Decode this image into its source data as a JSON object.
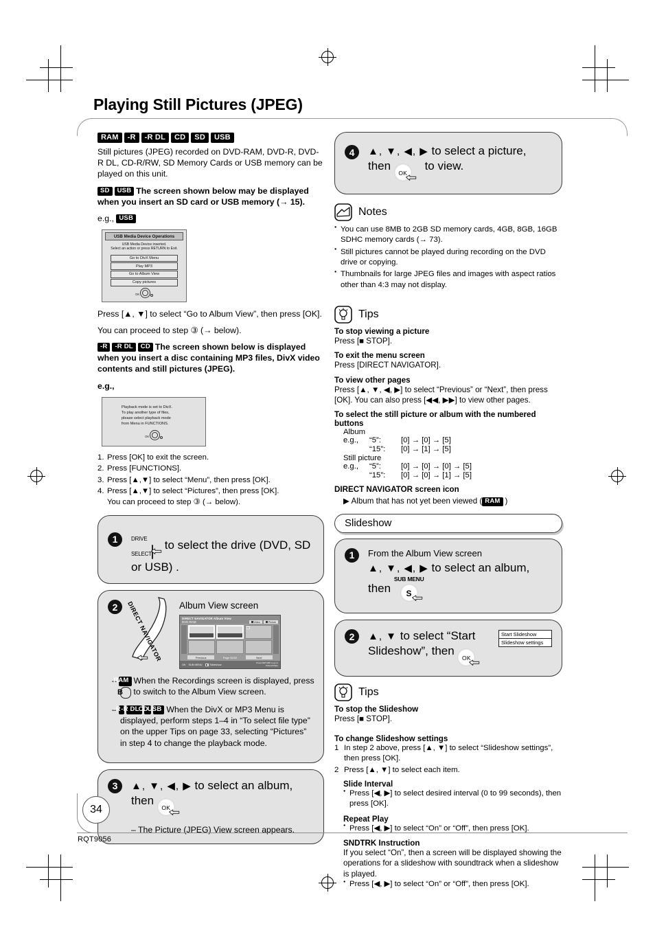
{
  "page": {
    "title": "Playing Still Pictures (JPEG)",
    "number": "34",
    "doc_code": "RQT9056"
  },
  "left": {
    "media_badges": [
      "RAM",
      "-R",
      "-R DL",
      "CD",
      "SD",
      "USB"
    ],
    "intro": "Still pictures (JPEG) recorded on DVD-RAM, DVD-R, DVD-R DL, CD-R/RW, SD Memory Cards or USB memory can be played on this unit.",
    "sd_usb_badges": [
      "SD",
      "USB"
    ],
    "sd_usb_text": "The screen shown below may be displayed when you insert an SD card or USB memory (→ 15).",
    "eg_label": "e.g.,",
    "eg_badge": "USB",
    "usb_screen": {
      "header": "USB Media Device Operations",
      "subtext_line1": "USB Media Device inserted.",
      "subtext_line2": "Select an action or press RETURN to Exit.",
      "options": [
        "Go to DivX Menu",
        "Play MP3",
        "Go to Album View",
        "Copy pictures"
      ],
      "ok_label": "OK"
    },
    "after_usb_line1": "Press [▲, ▼] to select “Go to Album View”, then press [OK].",
    "after_usb_line2": "You can proceed to step ③ (→ below).",
    "disc_badges": [
      "-R",
      "-R DL",
      "CD"
    ],
    "disc_text": "The screen shown below is displayed when you insert a disc containing MP3 files, DivX video contents and still pictures (JPEG).",
    "eg_label2": "e.g.,",
    "divx_screen": {
      "lines": [
        "Playback mode is set to DivX.",
        "To play another type of files,",
        "please select playback mode",
        "from Menu in FUNCTIONS."
      ],
      "ok_label": "OK"
    },
    "divx_steps": [
      "Press [OK] to exit the screen.",
      "Press [FUNCTIONS].",
      "Press [▲,▼] to select “Menu”, then press [OK].",
      "Press [▲,▼] to select “Pictures”, then press [OK]."
    ],
    "divx_steps_note": "You can proceed to step ③ (→ below).",
    "step1": {
      "num": "1",
      "key_cap_line1": "DRIVE",
      "key_cap_line2": "SELECT",
      "text": "to select the drive (DVD, SD or USB) ."
    },
    "step2": {
      "num": "2",
      "ribbon_label": "DIRECT NAVIGATOR",
      "screen_caption": "Album View screen",
      "album_screen": {
        "title": "DIRECT NAVIGATOR  Album View",
        "disc": "DVD-RAM",
        "btn_video": "Video",
        "btn_picture": "Picture",
        "cells": [
          {
            "num": "01",
            "caption_l1": "Hokkaido Travel",
            "caption_l2": "From 3/October",
            "selected": true
          },
          {
            "num": "02",
            "caption_l1": "Kyoto album",
            "caption_l2": "by Daddy",
            "selected": true
          },
          {
            "num": "03",
            "caption_l1": "",
            "caption_l2": "",
            "selected": false
          },
          {
            "num": "",
            "caption_l1": "",
            "caption_l2": "",
            "selected": false
          },
          {
            "num": "",
            "caption_l1": "",
            "caption_l2": "",
            "selected": false
          },
          {
            "num": "",
            "caption_l1": "",
            "caption_l2": "",
            "selected": false
          }
        ],
        "previous": "Previous",
        "page_label": "Page 02/02",
        "next": "Next",
        "bottom_ok": "OK",
        "bottom_submenu": "SUB MENU",
        "bottom_key": "▶",
        "bottom_slideshow": "Slideshow",
        "bottom_hint_l1": "Press RETURN to go to",
        "bottom_hint_l2": "Picture/Video"
      },
      "bullet1_badge": "RAM",
      "bullet1_text_a": "When the Recordings screen is displayed, press",
      "bullet1_key": "B",
      "bullet1_text_b": "to switch to the Album View screen.",
      "bullet2_badges": [
        "-R",
        "-R DL",
        "CD",
        "USB"
      ],
      "bullet2_text": "When the DivX or MP3 Menu is displayed, perform steps 1–4 in “To select file type” on the upper Tips on page 33, selecting “Pictures” in step 4 to change the playback mode."
    },
    "step3": {
      "num": "3",
      "arrows": "▲, ▼, ◀, ▶",
      "text": "to select an album,",
      "then": "then",
      "ok": "OK",
      "note": "– The Picture (JPEG) View screen appears."
    }
  },
  "right": {
    "step4": {
      "num": "4",
      "arrows": "▲, ▼, ◀, ▶",
      "text": "to select a picture,",
      "then": "then",
      "ok": "OK",
      "tail": "to view."
    },
    "notes": {
      "heading": "Notes",
      "items": [
        "You can use 8MB to 2GB SD memory cards, 4GB, 8GB, 16GB SDHC memory cards (→ 73).",
        "Still pictures cannot be played during recording on the DVD drive or copying.",
        "Thumbnails for large JPEG files and images with aspect ratios other than 4:3 may not display."
      ]
    },
    "tips1": {
      "heading": "Tips",
      "sections": [
        {
          "title": "To stop viewing a picture",
          "body": "Press [■ STOP]."
        },
        {
          "title": "To exit the menu screen",
          "body": "Press [DIRECT NAVIGATOR]."
        },
        {
          "title": "To view other pages",
          "body": "Press [▲, ▼, ◀, ▶] to select “Previous” or “Next”, then press [OK]. You can also press [◀◀, ▶▶] to view other pages."
        }
      ],
      "numbered_title": "To select the still picture or album with the numbered buttons",
      "album_label": "Album",
      "stillpicture_label": "Still picture",
      "eg_label": "e.g.,",
      "album_rows": [
        {
          "label": "“5”:",
          "keys": "[0] → [0] → [5]"
        },
        {
          "label": "“15”:",
          "keys": "[0] → [1] → [5]"
        }
      ],
      "still_rows": [
        {
          "label": "“5”:",
          "keys": "[0] → [0] → [0] → [5]"
        },
        {
          "label": "“15”:",
          "keys": "[0] → [0] → [1] → [5]"
        }
      ],
      "icon_title": "DIRECT NAVIGATOR screen icon",
      "icon_line_pre": "Album that has not yet been viewed (",
      "icon_line_badge": "RAM",
      "icon_line_post": ")"
    },
    "slideshow": {
      "section_title": "Slideshow",
      "step1": {
        "num": "1",
        "lead": "From the Album View screen",
        "arrows": "▲, ▼, ◀, ▶",
        "text": "to select an album,",
        "then": "then",
        "sub_label": "SUB MENU",
        "sub_key": "S"
      },
      "step2": {
        "num": "2",
        "arrows": "▲, ▼",
        "text_l1": "to select “Start",
        "text_l2": "Slideshow”, then",
        "ok": "OK",
        "menu_items": [
          "Start Slideshow",
          "Slideshow settings"
        ]
      }
    },
    "tips2": {
      "heading": "Tips",
      "stop_title": "To stop the Slideshow",
      "stop_body": "Press [■ STOP].",
      "change_title": "To change Slideshow settings",
      "steps": [
        {
          "n": "1",
          "text": "In step 2 above, press [▲, ▼] to select “Slideshow settings”, then press [OK]."
        },
        {
          "n": "2",
          "text": "Press [▲, ▼] to select each item."
        }
      ],
      "settings": [
        {
          "title": "Slide Interval",
          "bullets": [
            "Press [◀, ▶] to select desired interval (0 to 99 seconds), then press [OK]."
          ]
        },
        {
          "title": "Repeat Play",
          "bullets": [
            "Press [◀, ▶] to select “On” or “Off”, then press [OK]."
          ]
        },
        {
          "title": "SNDTRK Instruction",
          "note": "If you select “On”, then a screen will be displayed showing the operations for a slideshow with soundtrack when a slideshow is played.",
          "bullets": [
            "Press [◀, ▶] to select “On” or “Off”, then press [OK]."
          ]
        }
      ]
    }
  }
}
